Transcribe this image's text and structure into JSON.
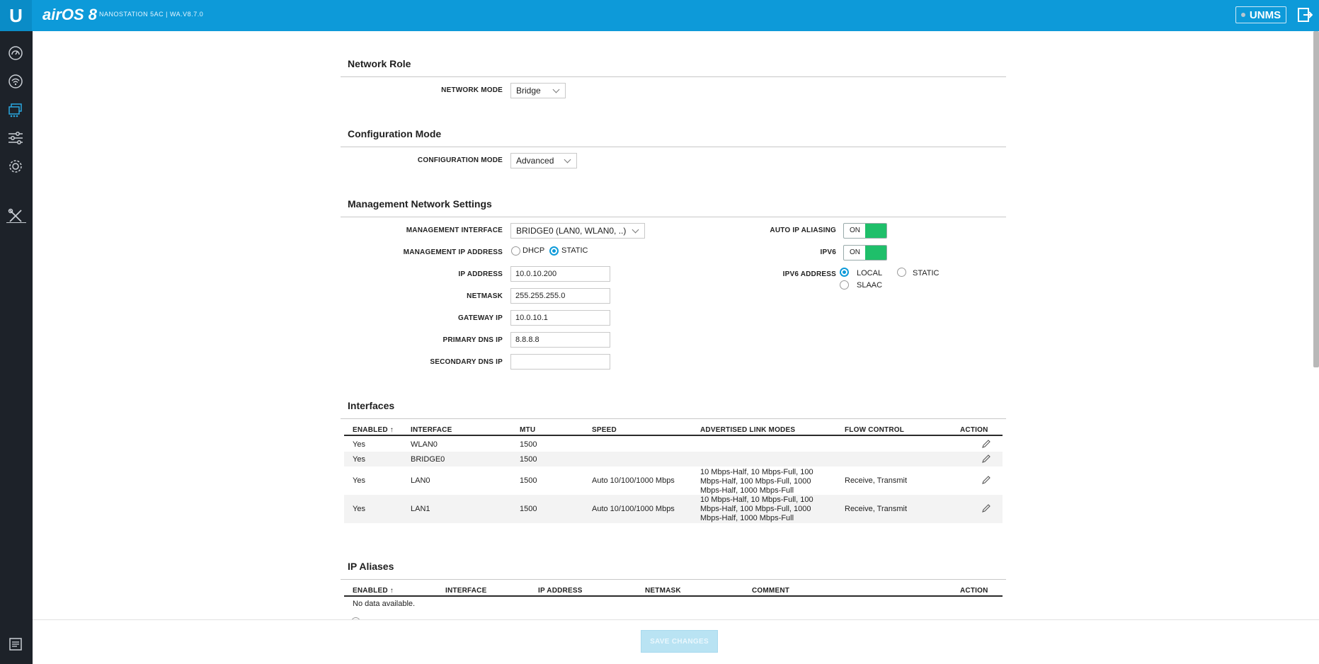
{
  "header": {
    "logo": "U",
    "brand": "airOS 8",
    "subtitle": "NANOSTATION 5AC | WA.V8.7.0",
    "unms_label": "UNMS"
  },
  "sidebar": {
    "icons": [
      "dashboard-icon",
      "wireless-icon",
      "network-icon",
      "services-icon",
      "system-icon",
      "tools-icon",
      "log-icon"
    ]
  },
  "network_role": {
    "title": "Network Role",
    "network_mode_label": "NETWORK MODE",
    "network_mode_value": "Bridge"
  },
  "configuration_mode": {
    "title": "Configuration Mode",
    "label": "CONFIGURATION MODE",
    "value": "Advanced"
  },
  "management": {
    "title": "Management Network Settings",
    "interface_label": "MANAGEMENT INTERFACE",
    "interface_value": "BRIDGE0 (LAN0, WLAN0, ..)",
    "ip_address_mode_label": "MANAGEMENT IP ADDRESS",
    "dhcp_label": "DHCP",
    "static_label": "STATIC",
    "ip_address_label": "IP ADDRESS",
    "ip_address_value": "10.0.10.200",
    "netmask_label": "NETMASK",
    "netmask_value": "255.255.255.0",
    "gateway_label": "GATEWAY IP",
    "gateway_value": "10.0.10.1",
    "primary_dns_label": "PRIMARY DNS IP",
    "primary_dns_value": "8.8.8.8",
    "secondary_dns_label": "SECONDARY DNS IP",
    "secondary_dns_value": "",
    "auto_ip_aliasing_label": "AUTO IP ALIASING",
    "auto_ip_aliasing_state": "ON",
    "ipv6_label": "IPV6",
    "ipv6_state": "ON",
    "ipv6_address_label": "IPV6 ADDRESS",
    "ipv6_local_label": "LOCAL",
    "ipv6_static_label": "STATIC",
    "ipv6_slaac_label": "SLAAC"
  },
  "interfaces": {
    "title": "Interfaces",
    "columns": [
      "ENABLED ↑",
      "INTERFACE",
      "MTU",
      "SPEED",
      "ADVERTISED LINK MODES",
      "FLOW CONTROL",
      "ACTION"
    ],
    "rows": [
      {
        "enabled": "Yes",
        "interface": "WLAN0",
        "mtu": "1500",
        "speed": "",
        "modes": "",
        "flow": ""
      },
      {
        "enabled": "Yes",
        "interface": "BRIDGE0",
        "mtu": "1500",
        "speed": "",
        "modes": "",
        "flow": ""
      },
      {
        "enabled": "Yes",
        "interface": "LAN0",
        "mtu": "1500",
        "speed": "Auto 10/100/1000 Mbps",
        "modes": "10 Mbps-Half, 10 Mbps-Full, 100 Mbps-Half, 100 Mbps-Full, 1000 Mbps-Half, 1000 Mbps-Full",
        "flow": "Receive, Transmit"
      },
      {
        "enabled": "Yes",
        "interface": "LAN1",
        "mtu": "1500",
        "speed": "Auto 10/100/1000 Mbps",
        "modes": "10 Mbps-Half, 10 Mbps-Full, 100 Mbps-Half, 100 Mbps-Full, 1000 Mbps-Half, 1000 Mbps-Full",
        "flow": "Receive, Transmit"
      }
    ]
  },
  "ip_aliases": {
    "title": "IP Aliases",
    "columns": [
      "ENABLED ↑",
      "INTERFACE",
      "IP ADDRESS",
      "NETMASK",
      "COMMENT",
      "ACTION"
    ],
    "empty_text": "No data available."
  },
  "footer": {
    "save_label": "SAVE CHANGES"
  },
  "colors": {
    "topbar": "#0d9ad9",
    "sidebar": "#1d2229",
    "toggle_on": "#1fbf6a"
  }
}
